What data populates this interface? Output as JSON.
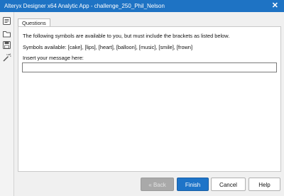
{
  "window": {
    "title": "Alteryx Designer x64 Analytic App - challenge_250_Phil_Nelson",
    "close_glyph": "✕"
  },
  "toolbar": {
    "icons": [
      "app-icon",
      "open-folder-icon",
      "save-icon",
      "magic-wand-icon"
    ]
  },
  "tabs": [
    {
      "label": "Questions",
      "active": true
    }
  ],
  "questions": {
    "intro": "The following symbols are available to you, but must include the brackets as listed below.",
    "symbols": "Symbols available: [cake], [lips], [heart], [balloon], [music], [smile], [frown]",
    "message_label": "Insert your message here:",
    "message_value": ""
  },
  "footer": {
    "back_label": "« Back",
    "finish_label": "Finish",
    "cancel_label": "Cancel",
    "help_label": "Help",
    "back_enabled": false
  },
  "colors": {
    "title_bar": "#1e73c4",
    "primary_button": "#1e74c8",
    "disabled_button": "#a9a9a9"
  }
}
